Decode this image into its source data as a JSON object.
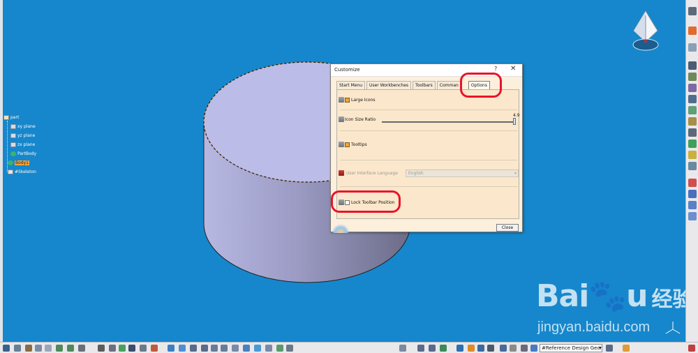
{
  "tree": {
    "root": "part",
    "items": [
      {
        "label": "xy plane"
      },
      {
        "label": "yz plane"
      },
      {
        "label": "zx plane"
      },
      {
        "label": "PartBody"
      },
      {
        "label": "Body1"
      },
      {
        "label": "#Skeleton"
      }
    ]
  },
  "dialog": {
    "title": "Customize",
    "help": "?",
    "close_glyph": "✕",
    "tabs": [
      {
        "label": "Start Menu"
      },
      {
        "label": "User Workbenches"
      },
      {
        "label": "Toolbars"
      },
      {
        "label": "Comman"
      },
      {
        "label": "Options"
      }
    ],
    "options": {
      "large_icons": "Large Icons",
      "large_icons_checked": true,
      "icon_size_ratio": "Icon Size Ratio",
      "icon_size_value": "4.9",
      "tooltips": "Tooltips",
      "tooltips_checked": true,
      "ui_language": "User Interface Language",
      "ui_language_value": "English",
      "lock_toolbar": "Lock Toolbar Position",
      "lock_toolbar_checked": false
    },
    "close_button": "Close"
  },
  "bottom_toolbar": {
    "reference_select": "#Reference Design Geome"
  },
  "watermark": {
    "brand": "Bai",
    "brand_end": "u",
    "chinese": "经验",
    "url": "jingyan.baidu.com"
  },
  "colors": {
    "viewport": "#1687cc",
    "highlight": "#e8132b",
    "selection": "#f4a53b"
  }
}
